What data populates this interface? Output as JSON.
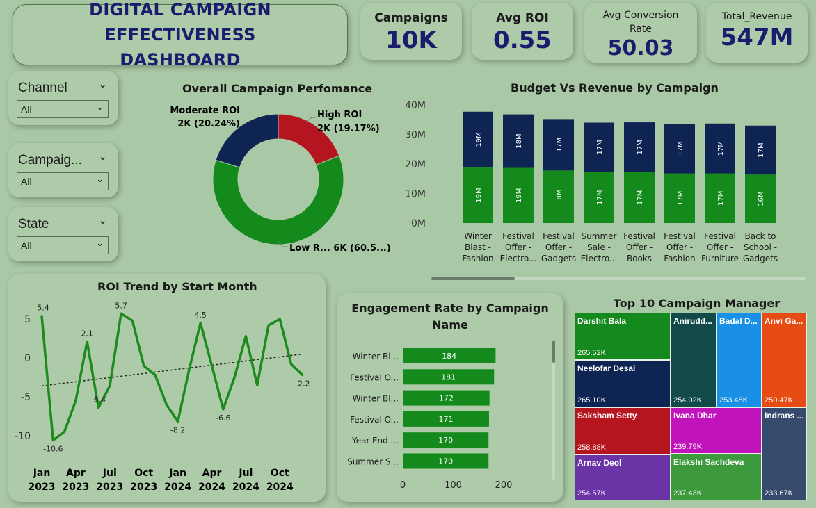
{
  "header": {
    "title_line1": "DIGITAL CAMPAIGN EFFECTIVENESS",
    "title_line2": "DASHBOARD"
  },
  "kpis": [
    {
      "label": "Campaigns",
      "value": "10K"
    },
    {
      "label": "Avg ROI",
      "value": "0.55"
    },
    {
      "label": "Avg Conversion Rate",
      "value": "50.03"
    },
    {
      "label": "Total_Revenue",
      "value": "547M"
    }
  ],
  "slicers": [
    {
      "label": "Channel",
      "value": "All"
    },
    {
      "label": "Campaig...",
      "value": "All"
    },
    {
      "label": "State",
      "value": "All"
    }
  ],
  "colors": {
    "navy": "#0e2452",
    "green": "#158a1c",
    "red": "#b5151e",
    "title": "#1c1c6e"
  },
  "chart_data": [
    {
      "type": "pie",
      "title": "Overall Campaign Perfomance",
      "slices": [
        {
          "name": "High ROI",
          "value": 19.17,
          "label": "High ROI",
          "sublabel": "2K (19.17%)",
          "color": "#b5151e"
        },
        {
          "name": "Low ROI",
          "value": 60.59,
          "label": "Low R... 6K (60.5...)",
          "sublabel": "",
          "color": "#158a1c"
        },
        {
          "name": "Moderate ROI",
          "value": 20.24,
          "label": "Moderate ROI",
          "sublabel": "2K (20.24%)",
          "color": "#0e2452"
        }
      ]
    },
    {
      "type": "bar",
      "title": "Budget Vs Revenue by Campaign",
      "categories": [
        "Winter Blast - Fashion",
        "Festival Offer - Electro...",
        "Festival Offer - Gadgets",
        "Summer Sale - Electro...",
        "Festival Offer - Books",
        "Festival Offer - Fashion",
        "Festival Offer - Furniture",
        "Back to School - Gadgets"
      ],
      "category_lines": [
        [
          "Winter",
          "Blast -",
          "Fashion"
        ],
        [
          "Festival",
          "Offer -",
          "Electro..."
        ],
        [
          "Festival",
          "Offer -",
          "Gadgets"
        ],
        [
          "Summer",
          "Sale -",
          "Electro..."
        ],
        [
          "Festival",
          "Offer -",
          "Books"
        ],
        [
          "Festival",
          "Offer -",
          "Fashion"
        ],
        [
          "Festival",
          "Offer -",
          "Furniture"
        ],
        [
          "Back to",
          "School -",
          "Gadgets"
        ]
      ],
      "series": [
        {
          "color": "#158a1c",
          "values": [
            18.8,
            18.7,
            17.8,
            17.3,
            17.2,
            16.8,
            16.8,
            16.4
          ],
          "labels": [
            "19M",
            "19M",
            "18M",
            "17M",
            "17M",
            "17M",
            "17M",
            "16M"
          ]
        },
        {
          "color": "#0e2452",
          "values": [
            18.9,
            18.1,
            17.4,
            16.7,
            16.9,
            16.7,
            16.9,
            16.6
          ],
          "labels": [
            "19M",
            "18M",
            "17M",
            "17M",
            "17M",
            "17M",
            "17M",
            "17M"
          ]
        }
      ],
      "ylim": [
        0,
        40
      ],
      "yticks": [
        "0M",
        "10M",
        "20M",
        "30M",
        "40M"
      ]
    },
    {
      "type": "line",
      "title": "ROI Trend by Start Month",
      "x_ticks": [
        [
          "Jan",
          "2023"
        ],
        [
          "Apr",
          "2023"
        ],
        [
          "Jul",
          "2023"
        ],
        [
          "Oct",
          "2023"
        ],
        [
          "Jan",
          "2024"
        ],
        [
          "Apr",
          "2024"
        ],
        [
          "Jul",
          "2024"
        ],
        [
          "Oct",
          "2024"
        ]
      ],
      "x": [
        "2023-01",
        "2023-02",
        "2023-03",
        "2023-04",
        "2023-05",
        "2023-06",
        "2023-07",
        "2023-08",
        "2023-09",
        "2023-10",
        "2023-11",
        "2023-12",
        "2024-01",
        "2024-02",
        "2024-03",
        "2024-04",
        "2024-05",
        "2024-06",
        "2024-07",
        "2024-08",
        "2024-09",
        "2024-10",
        "2024-11",
        "2024-12"
      ],
      "values": [
        5.4,
        -10.6,
        -9.5,
        -5.5,
        2.1,
        -6.4,
        -3.6,
        5.7,
        4.8,
        -1.0,
        -2.2,
        -6.0,
        -8.2,
        -1.5,
        4.5,
        -1.0,
        -6.6,
        -2.5,
        2.8,
        -3.5,
        4.2,
        5.0,
        -0.8,
        -2.2
      ],
      "point_labels": {
        "0": "5.4",
        "1": "-10.6",
        "4": "2.1",
        "5": "-6.4",
        "7": "5.7",
        "12": "-8.2",
        "14": "4.5",
        "16": "-6.6",
        "23": "-2.2"
      },
      "trend": [
        -3.6,
        0.5
      ],
      "ylim": [
        -11,
        6
      ],
      "yticks": [
        "5",
        "0",
        "-5",
        "-10"
      ]
    },
    {
      "type": "bar",
      "orientation": "horizontal",
      "title": "Engagement Rate by Campaign Name",
      "categories": [
        "Winter Bl...",
        "Festival O...",
        "Winter Bl...",
        "Festival O...",
        "Year-End ...",
        "Summer S..."
      ],
      "values": [
        184,
        181,
        172,
        171,
        170,
        170
      ],
      "xlim": [
        0,
        200
      ],
      "xticks": [
        "0",
        "100",
        "200"
      ]
    },
    {
      "type": "treemap",
      "title": "Top 10 Campaign Manager",
      "items": [
        {
          "name": "Darshit Bala",
          "value": "265.52K",
          "color": "#148a1e"
        },
        {
          "name": "Neelofar Desai",
          "value": "265.10K",
          "color": "#0e2452"
        },
        {
          "name": "Saksham Setty",
          "value": "258.88K",
          "color": "#b5151e"
        },
        {
          "name": "Arnav Deol",
          "value": "254.57K",
          "color": "#6b34a6"
        },
        {
          "name": "Anirudd...",
          "value": "254.02K",
          "color": "#124a4a"
        },
        {
          "name": "Badal D...",
          "value": "253.48K",
          "color": "#1a8fe6"
        },
        {
          "name": "Anvi Ga...",
          "value": "250.47K",
          "color": "#e54b12"
        },
        {
          "name": "Ivana Dhar",
          "value": "239.79K",
          "color": "#c113bc"
        },
        {
          "name": "Elakshi Sachdeva",
          "value": "237.43K",
          "color": "#3c9a3c"
        },
        {
          "name": "Indrans ...",
          "value": "233.67K",
          "color": "#364a6e"
        }
      ]
    }
  ]
}
